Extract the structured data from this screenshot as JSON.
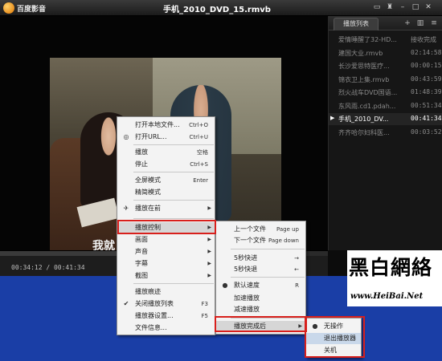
{
  "titlebar": {
    "app_name": "百度影音",
    "file_title": "手机_2010_DVD_15.rmvb"
  },
  "video": {
    "subtitle": "我就"
  },
  "playlist": {
    "tab": "播放列表",
    "items": [
      {
        "name": "爱情睡醒了32-HD...",
        "time": "接收完成",
        "active": false
      },
      {
        "name": "建国大业.rmvb",
        "time": "02:14:58",
        "active": false
      },
      {
        "name": "长沙爱思特医疗...",
        "time": "00:00:15",
        "active": false
      },
      {
        "name": "锦衣卫上集.rmvb",
        "time": "00:43:59",
        "active": false
      },
      {
        "name": "烈火战车DVD国语...",
        "time": "01:48:39",
        "active": false
      },
      {
        "name": "东风雨.cd1.pdah...",
        "time": "00:51:34",
        "active": false
      },
      {
        "name": "手机_2010_DV...",
        "time": "00:41:34",
        "active": true
      },
      {
        "name": "齐齐哈尔妇科医...",
        "time": "00:03:52",
        "active": false
      }
    ]
  },
  "controls": {
    "time": "00:34:12 / 00:41:34",
    "progress": 0.823
  },
  "watermark": {
    "cn": "黑白網絡",
    "url": "www.HeiBai.Net"
  },
  "context_menu": {
    "items": [
      {
        "label": "打开本地文件...",
        "shortcut": "Ctrl+O"
      },
      {
        "label": "打开URL...",
        "shortcut": "Ctrl+U",
        "icon": "globe-icon"
      },
      {
        "label": "播放",
        "shortcut": "空格"
      },
      {
        "label": "停止",
        "shortcut": "Ctrl+S"
      },
      {
        "label": "全屏模式",
        "shortcut": "Enter"
      },
      {
        "label": "精简模式",
        "shortcut": ""
      },
      {
        "label": "播放在前",
        "shortcut": "",
        "icon": "pin-icon"
      },
      {
        "label": "播放控制",
        "shortcut": ""
      },
      {
        "label": "画面",
        "shortcut": ""
      },
      {
        "label": "声音",
        "shortcut": ""
      },
      {
        "label": "字幕",
        "shortcut": ""
      },
      {
        "label": "截图",
        "shortcut": ""
      },
      {
        "label": "播放痕迹",
        "shortcut": ""
      },
      {
        "label": "关闭播放列表",
        "shortcut": "F3",
        "icon": "check-icon"
      },
      {
        "label": "播放器设置...",
        "shortcut": "F5"
      },
      {
        "label": "文件信息...",
        "shortcut": ""
      }
    ]
  },
  "playback_menu": {
    "items": [
      {
        "label": "上一个文件",
        "shortcut": "Page up"
      },
      {
        "label": "下一个文件",
        "shortcut": "Page down"
      },
      {
        "label": "5秒快进",
        "shortcut": "→"
      },
      {
        "label": "5秒快退",
        "shortcut": "←"
      },
      {
        "label": "默认速度",
        "shortcut": "R",
        "icon": "radio-dot-icon"
      },
      {
        "label": "加速播放",
        "shortcut": ""
      },
      {
        "label": "减速播放",
        "shortcut": ""
      },
      {
        "label": "播放完成后",
        "shortcut": ""
      }
    ]
  },
  "after_menu": {
    "items": [
      {
        "label": "无操作",
        "icon": "radio-dot-icon"
      },
      {
        "label": "退出播放器"
      },
      {
        "label": "关机"
      }
    ]
  }
}
